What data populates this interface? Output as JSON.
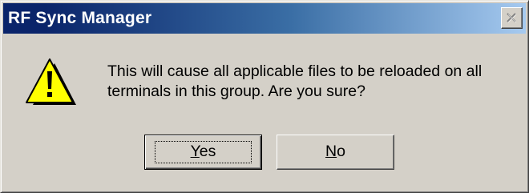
{
  "dialog": {
    "title": "RF Sync Manager",
    "message_line1": "This will cause all applicable files to be reloaded on all",
    "message_line2": "terminals in this group.  Are you sure?",
    "icon": "warning-icon"
  },
  "buttons": {
    "yes": {
      "mnemonic": "Y",
      "rest": "es"
    },
    "no": {
      "mnemonic": "N",
      "rest": "o"
    }
  },
  "colors": {
    "titlebar_start": "#0a246a",
    "titlebar_end": "#a6caf0",
    "face": "#d4d0c8",
    "warning_yellow": "#ffff00"
  }
}
